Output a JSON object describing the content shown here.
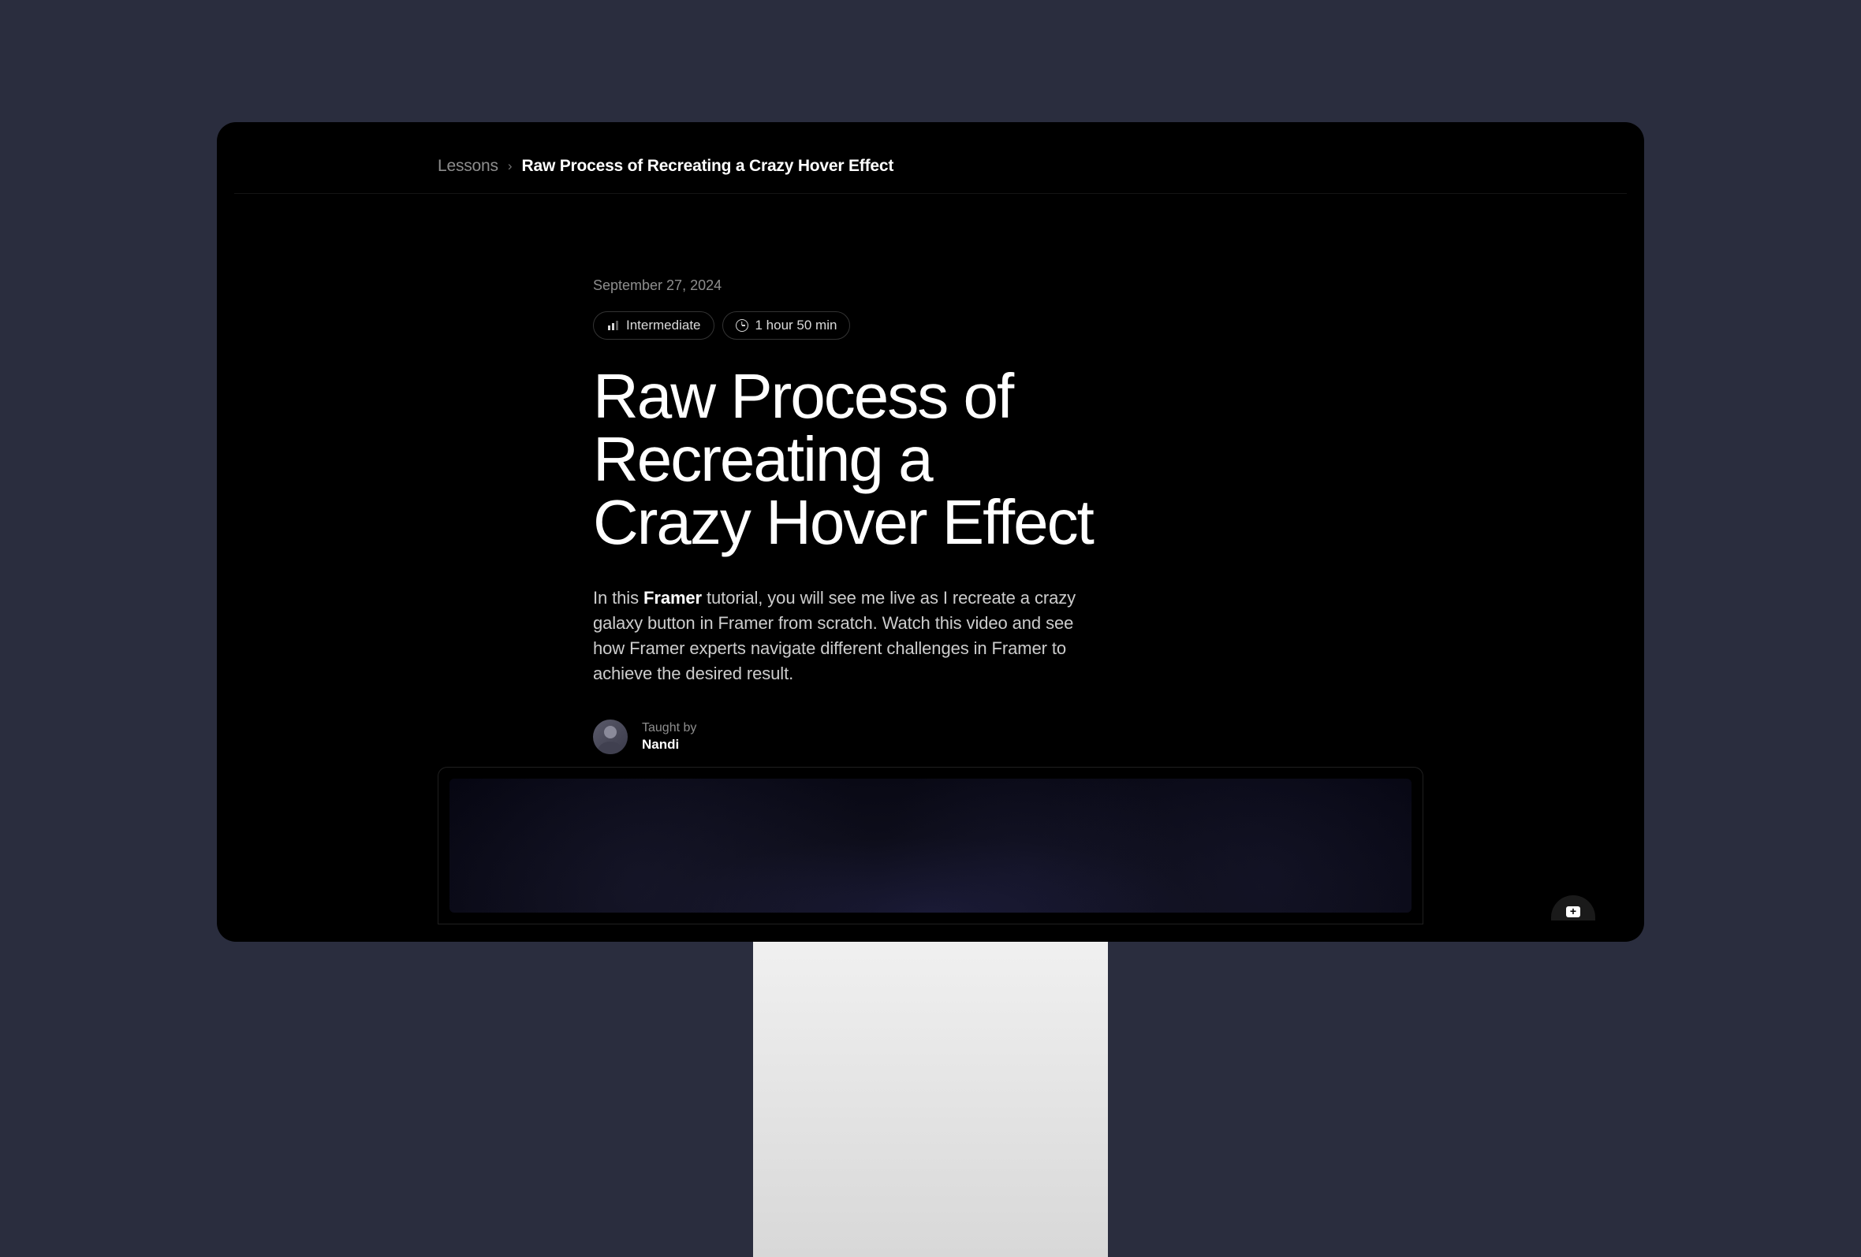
{
  "breadcrumb": {
    "link_label": "Lessons",
    "separator": "›",
    "current": "Raw Process of Recreating a Crazy Hover Effect"
  },
  "meta": {
    "date": "September 27, 2024",
    "level": "Intermediate",
    "duration": "1 hour 50 min"
  },
  "title": "Raw Process of Recreating a Crazy Hover Effect",
  "description": {
    "prefix": "In this ",
    "link_text": "Framer",
    "suffix": " tutorial, you will see me live as I recreate a crazy galaxy button in Framer from scratch. Watch this video and see how Framer experts navigate different challenges in Framer to achieve the desired result."
  },
  "instructor": {
    "taught_by_label": "Taught by",
    "name": "Nandi"
  }
}
